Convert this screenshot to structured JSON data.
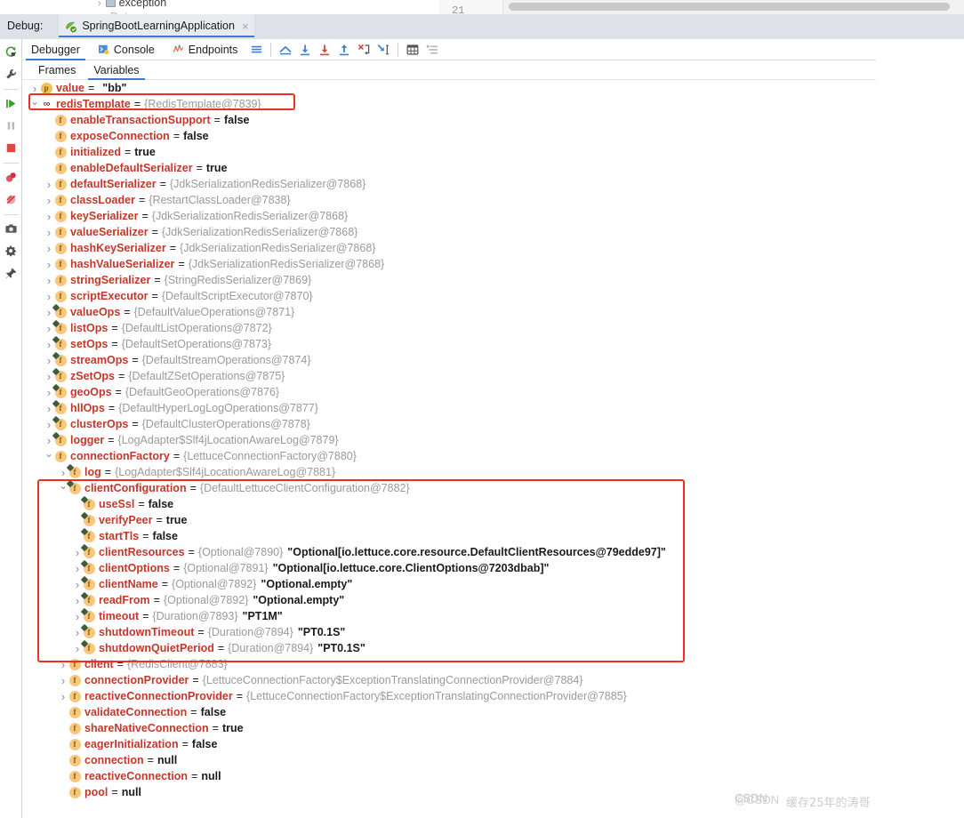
{
  "editor_strip": {
    "tree_item": "exception",
    "tree_item_dim": "Data",
    "line_number": "21"
  },
  "debug_header": {
    "label": "Debug:",
    "tab_title": "SpringBootLearningApplication",
    "tab_close": "×",
    "tab_icon": "spring-boot-run-icon"
  },
  "left_rail": {
    "items": [
      {
        "name": "rerun-icon",
        "title": "Rerun"
      },
      {
        "name": "wrench-settings-icon",
        "title": "Settings"
      },
      {
        "name": "resume-program-icon",
        "title": "Resume Program"
      },
      {
        "name": "pause-program-icon",
        "title": "Pause Program"
      },
      {
        "name": "stop-icon",
        "title": "Stop"
      },
      {
        "name": "view-breakpoints-icon",
        "title": "View Breakpoints"
      },
      {
        "name": "mute-breakpoints-icon",
        "title": "Mute Breakpoints"
      },
      {
        "name": "camera-snapshot-icon",
        "title": "Get Thread Dump"
      },
      {
        "name": "gear-settings-icon",
        "title": "Settings"
      },
      {
        "name": "pin-tab-icon",
        "title": "Pin Tab"
      }
    ]
  },
  "debugger_toolbar": {
    "tabs": [
      {
        "label": "Debugger",
        "icon": "debugger-icon",
        "active": true
      },
      {
        "label": "Console",
        "icon": "console-icon",
        "active": false
      },
      {
        "label": "Endpoints",
        "icon": "endpoints-icon",
        "active": false
      }
    ],
    "buttons": [
      {
        "name": "layout-lines-icon",
        "title": "Layout"
      },
      {
        "name": "show-execution-point-icon",
        "title": "Show Execution Point"
      },
      {
        "name": "step-over-icon",
        "title": "Step Over"
      },
      {
        "name": "step-into-icon",
        "title": "Step Into"
      },
      {
        "name": "step-out-icon",
        "title": "Step Out"
      },
      {
        "name": "force-step-into-icon",
        "title": "Force Step Into"
      },
      {
        "name": "run-to-cursor-icon",
        "title": "Run to Cursor"
      },
      {
        "name": "evaluate-expression-icon",
        "title": "Evaluate Expression"
      },
      {
        "name": "settings-list-icon",
        "title": "Layout Settings"
      }
    ]
  },
  "sub_tabs": [
    {
      "label": "Frames",
      "active": false
    },
    {
      "label": "Variables",
      "active": true
    }
  ],
  "variables": [
    {
      "indent": 0,
      "caret": "closed",
      "icon": "param",
      "final": false,
      "name": "value",
      "type": "",
      "value": "\"bb\"",
      "value_kind": "str"
    },
    {
      "indent": 0,
      "caret": "open",
      "icon": "watch",
      "final": false,
      "name": "redisTemplate",
      "type": "{RedisTemplate@7839}",
      "value": "",
      "value_kind": ""
    },
    {
      "indent": 1,
      "caret": "none",
      "icon": "field",
      "final": false,
      "name": "enableTransactionSupport",
      "type": "",
      "value": "false",
      "value_kind": "val"
    },
    {
      "indent": 1,
      "caret": "none",
      "icon": "field",
      "final": false,
      "name": "exposeConnection",
      "type": "",
      "value": "false",
      "value_kind": "val"
    },
    {
      "indent": 1,
      "caret": "none",
      "icon": "field",
      "final": false,
      "name": "initialized",
      "type": "",
      "value": "true",
      "value_kind": "val"
    },
    {
      "indent": 1,
      "caret": "none",
      "icon": "field",
      "final": false,
      "name": "enableDefaultSerializer",
      "type": "",
      "value": "true",
      "value_kind": "val"
    },
    {
      "indent": 1,
      "caret": "closed",
      "icon": "field",
      "final": false,
      "name": "defaultSerializer",
      "type": "{JdkSerializationRedisSerializer@7868}",
      "value": "",
      "value_kind": ""
    },
    {
      "indent": 1,
      "caret": "closed",
      "icon": "field",
      "final": false,
      "name": "classLoader",
      "type": "{RestartClassLoader@7838}",
      "value": "",
      "value_kind": ""
    },
    {
      "indent": 1,
      "caret": "closed",
      "icon": "field",
      "final": false,
      "name": "keySerializer",
      "type": "{JdkSerializationRedisSerializer@7868}",
      "value": "",
      "value_kind": ""
    },
    {
      "indent": 1,
      "caret": "closed",
      "icon": "field",
      "final": false,
      "name": "valueSerializer",
      "type": "{JdkSerializationRedisSerializer@7868}",
      "value": "",
      "value_kind": ""
    },
    {
      "indent": 1,
      "caret": "closed",
      "icon": "field",
      "final": false,
      "name": "hashKeySerializer",
      "type": "{JdkSerializationRedisSerializer@7868}",
      "value": "",
      "value_kind": ""
    },
    {
      "indent": 1,
      "caret": "closed",
      "icon": "field",
      "final": false,
      "name": "hashValueSerializer",
      "type": "{JdkSerializationRedisSerializer@7868}",
      "value": "",
      "value_kind": ""
    },
    {
      "indent": 1,
      "caret": "closed",
      "icon": "field",
      "final": false,
      "name": "stringSerializer",
      "type": "{StringRedisSerializer@7869}",
      "value": "",
      "value_kind": ""
    },
    {
      "indent": 1,
      "caret": "closed",
      "icon": "field",
      "final": false,
      "name": "scriptExecutor",
      "type": "{DefaultScriptExecutor@7870}",
      "value": "",
      "value_kind": ""
    },
    {
      "indent": 1,
      "caret": "closed",
      "icon": "field",
      "final": true,
      "name": "valueOps",
      "type": "{DefaultValueOperations@7871}",
      "value": "",
      "value_kind": ""
    },
    {
      "indent": 1,
      "caret": "closed",
      "icon": "field",
      "final": true,
      "name": "listOps",
      "type": "{DefaultListOperations@7872}",
      "value": "",
      "value_kind": ""
    },
    {
      "indent": 1,
      "caret": "closed",
      "icon": "field",
      "final": true,
      "name": "setOps",
      "type": "{DefaultSetOperations@7873}",
      "value": "",
      "value_kind": ""
    },
    {
      "indent": 1,
      "caret": "closed",
      "icon": "field",
      "final": true,
      "name": "streamOps",
      "type": "{DefaultStreamOperations@7874}",
      "value": "",
      "value_kind": ""
    },
    {
      "indent": 1,
      "caret": "closed",
      "icon": "field",
      "final": true,
      "name": "zSetOps",
      "type": "{DefaultZSetOperations@7875}",
      "value": "",
      "value_kind": ""
    },
    {
      "indent": 1,
      "caret": "closed",
      "icon": "field",
      "final": true,
      "name": "geoOps",
      "type": "{DefaultGeoOperations@7876}",
      "value": "",
      "value_kind": ""
    },
    {
      "indent": 1,
      "caret": "closed",
      "icon": "field",
      "final": true,
      "name": "hllOps",
      "type": "{DefaultHyperLogLogOperations@7877}",
      "value": "",
      "value_kind": ""
    },
    {
      "indent": 1,
      "caret": "closed",
      "icon": "field",
      "final": true,
      "name": "clusterOps",
      "type": "{DefaultClusterOperations@7878}",
      "value": "",
      "value_kind": ""
    },
    {
      "indent": 1,
      "caret": "closed",
      "icon": "field",
      "final": true,
      "name": "logger",
      "type": "{LogAdapter$Slf4jLocationAwareLog@7879}",
      "value": "",
      "value_kind": ""
    },
    {
      "indent": 1,
      "caret": "open",
      "icon": "field",
      "final": false,
      "name": "connectionFactory",
      "type": "{LettuceConnectionFactory@7880}",
      "value": "",
      "value_kind": ""
    },
    {
      "indent": 2,
      "caret": "closed",
      "icon": "field",
      "final": true,
      "name": "log",
      "type": "{LogAdapter$Slf4jLocationAwareLog@7881}",
      "value": "",
      "value_kind": ""
    },
    {
      "indent": 2,
      "caret": "open",
      "icon": "field",
      "final": true,
      "name": "clientConfiguration",
      "type": "{DefaultLettuceClientConfiguration@7882}",
      "value": "",
      "value_kind": ""
    },
    {
      "indent": 3,
      "caret": "none",
      "icon": "field",
      "final": true,
      "name": "useSsl",
      "type": "",
      "value": "false",
      "value_kind": "val"
    },
    {
      "indent": 3,
      "caret": "none",
      "icon": "field",
      "final": true,
      "name": "verifyPeer",
      "type": "",
      "value": "true",
      "value_kind": "val"
    },
    {
      "indent": 3,
      "caret": "none",
      "icon": "field",
      "final": true,
      "name": "startTls",
      "type": "",
      "value": "false",
      "value_kind": "val"
    },
    {
      "indent": 3,
      "caret": "closed",
      "icon": "field",
      "final": true,
      "name": "clientResources",
      "type": "{Optional@7890}",
      "value": "\"Optional[io.lettuce.core.resource.DefaultClientResources@79edde97]\"",
      "value_kind": "str"
    },
    {
      "indent": 3,
      "caret": "closed",
      "icon": "field",
      "final": true,
      "name": "clientOptions",
      "type": "{Optional@7891}",
      "value": "\"Optional[io.lettuce.core.ClientOptions@7203dbab]\"",
      "value_kind": "str"
    },
    {
      "indent": 3,
      "caret": "closed",
      "icon": "field",
      "final": true,
      "name": "clientName",
      "type": "{Optional@7892}",
      "value": "\"Optional.empty\"",
      "value_kind": "str"
    },
    {
      "indent": 3,
      "caret": "closed",
      "icon": "field",
      "final": true,
      "name": "readFrom",
      "type": "{Optional@7892}",
      "value": "\"Optional.empty\"",
      "value_kind": "str"
    },
    {
      "indent": 3,
      "caret": "closed",
      "icon": "field",
      "final": true,
      "name": "timeout",
      "type": "{Duration@7893}",
      "value": "\"PT1M\"",
      "value_kind": "str"
    },
    {
      "indent": 3,
      "caret": "closed",
      "icon": "field",
      "final": true,
      "name": "shutdownTimeout",
      "type": "{Duration@7894}",
      "value": "\"PT0.1S\"",
      "value_kind": "str"
    },
    {
      "indent": 3,
      "caret": "closed",
      "icon": "field",
      "final": true,
      "name": "shutdownQuietPeriod",
      "type": "{Duration@7894}",
      "value": "\"PT0.1S\"",
      "value_kind": "str"
    },
    {
      "indent": 2,
      "caret": "closed",
      "icon": "field",
      "final": false,
      "name": "client",
      "type": "{RedisClient@7883}",
      "value": "",
      "value_kind": ""
    },
    {
      "indent": 2,
      "caret": "closed",
      "icon": "field",
      "final": false,
      "name": "connectionProvider",
      "type": "{LettuceConnectionFactory$ExceptionTranslatingConnectionProvider@7884}",
      "value": "",
      "value_kind": ""
    },
    {
      "indent": 2,
      "caret": "closed",
      "icon": "field",
      "final": false,
      "name": "reactiveConnectionProvider",
      "type": "{LettuceConnectionFactory$ExceptionTranslatingConnectionProvider@7885}",
      "value": "",
      "value_kind": ""
    },
    {
      "indent": 2,
      "caret": "none",
      "icon": "field",
      "final": false,
      "name": "validateConnection",
      "type": "",
      "value": "false",
      "value_kind": "val"
    },
    {
      "indent": 2,
      "caret": "none",
      "icon": "field",
      "final": false,
      "name": "shareNativeConnection",
      "type": "",
      "value": "true",
      "value_kind": "val"
    },
    {
      "indent": 2,
      "caret": "none",
      "icon": "field",
      "final": false,
      "name": "eagerInitialization",
      "type": "",
      "value": "false",
      "value_kind": "val"
    },
    {
      "indent": 2,
      "caret": "none",
      "icon": "field",
      "final": false,
      "name": "connection",
      "type": "",
      "value": "null",
      "value_kind": "val"
    },
    {
      "indent": 2,
      "caret": "none",
      "icon": "field",
      "final": false,
      "name": "reactiveConnection",
      "type": "",
      "value": "null",
      "value_kind": "val"
    },
    {
      "indent": 2,
      "caret": "none",
      "icon": "field",
      "final": false,
      "name": "pool",
      "type": "",
      "value": "null",
      "value_kind": "val"
    }
  ],
  "highlights": [
    {
      "name": "redis-template-highlight",
      "color": "#f02f20"
    },
    {
      "name": "client-configuration-highlight",
      "color": "#f02f20"
    }
  ],
  "watermark": {
    "text_a": "CSDN",
    "text_b": "@CSDN",
    "text_c": "缓存25年的涛哥"
  }
}
